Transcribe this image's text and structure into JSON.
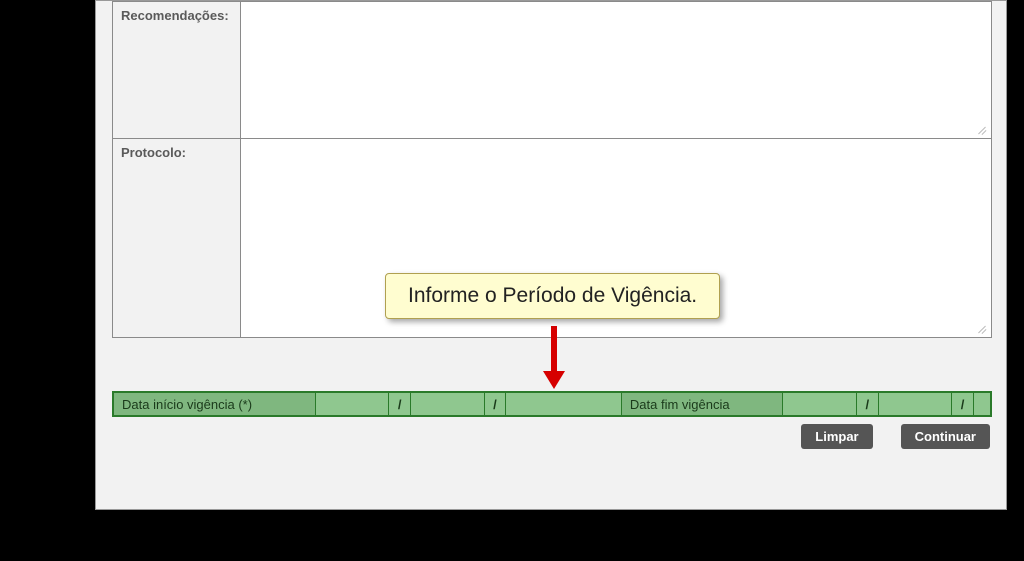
{
  "form": {
    "recomendacoes_label": "Recomendações:",
    "protocolo_label": "Protocolo:",
    "recomendacoes_value": "",
    "protocolo_value": ""
  },
  "callout": {
    "text": "Informe o Período de Vigência."
  },
  "green_bar": {
    "start_label": "Data início vigência (*)",
    "end_label": "Data fim vigência",
    "sep": "/",
    "start_day": "",
    "start_month": "",
    "start_year": "",
    "end_day": "",
    "end_month": "",
    "end_year": ""
  },
  "buttons": {
    "clear": "Limpar",
    "continue": "Continuar"
  }
}
